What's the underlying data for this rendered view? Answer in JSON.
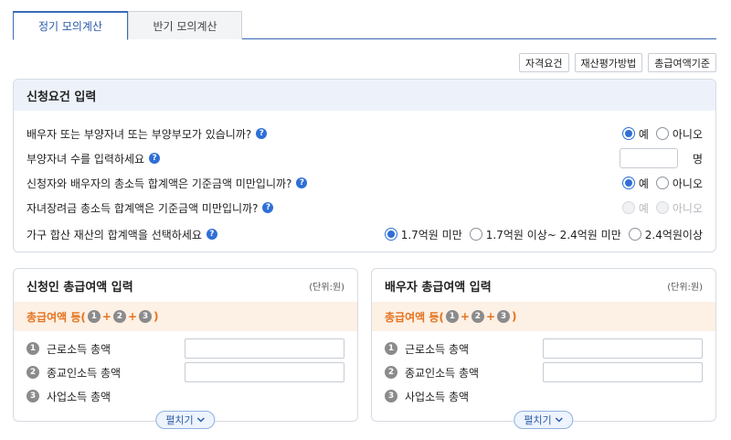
{
  "tabs": {
    "active": "정기 모의계산",
    "inactive": "반기 모의계산"
  },
  "toplinks": {
    "req": "자격요건",
    "asset": "재산평가방법",
    "criteria": "총급여액기준"
  },
  "requirements": {
    "title": "신청요건 입력",
    "q1": {
      "text": "배우자 또는 부양자녀 또는 부양부모가 있습니까?",
      "yes": "예",
      "no": "아니오"
    },
    "q2": {
      "text": "부양자녀 수를 입력하세요",
      "unit": "명"
    },
    "q3": {
      "text": "신청자와 배우자의 총소득 합계액은 기준금액 미만입니까?",
      "yes": "예",
      "no": "아니오"
    },
    "q4": {
      "text": "자녀장려금 총소득 합계액은 기준금액 미만입니까?",
      "yes": "예",
      "no": "아니오"
    },
    "q5": {
      "text": "가구 합산 재산의 합계액을 선택하세요",
      "opt1": "1.7억원 미만",
      "opt2": "1.7억원 이상~ 2.4억원 미만",
      "opt3": "2.4억원이상"
    },
    "help": "?"
  },
  "applicant": {
    "title": "신청인 총급여액 입력",
    "unit": "(단위:원)",
    "sum_prefix": "총급여액 등(",
    "sum_suffix": ")",
    "n1": "1",
    "n2": "2",
    "n3": "3",
    "plus": "+",
    "row1": "근로소득 총액",
    "row2": "종교인소득 총액",
    "row3": "사업소득 총액",
    "expand": "펼치기"
  },
  "spouse": {
    "title": "배우자 총급여액 입력",
    "unit": "(단위:원)",
    "sum_prefix": "총급여액 등(",
    "sum_suffix": ")",
    "n1": "1",
    "n2": "2",
    "n3": "3",
    "plus": "+",
    "row1": "근로소득 총액",
    "row2": "종교인소득 총액",
    "row3": "사업소득 총액",
    "expand": "펼치기"
  }
}
